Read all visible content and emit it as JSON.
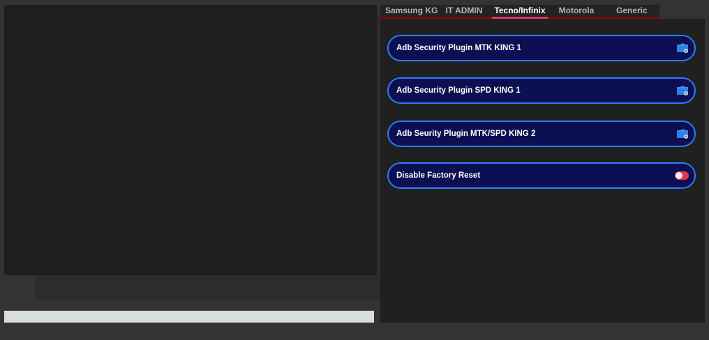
{
  "tabs": [
    {
      "label": "Samsung KG",
      "active": false
    },
    {
      "label": "IT ADMIN",
      "active": false
    },
    {
      "label": "Tecno/Infinix",
      "active": true
    },
    {
      "label": "Motorola",
      "active": false
    },
    {
      "label": "Generic",
      "active": false
    }
  ],
  "options": [
    {
      "label": "Adb Security Plugin MTK KING 1",
      "icon": "plugin-folder-icon"
    },
    {
      "label": "Adb Security Plugin SPD KING 1",
      "icon": "plugin-folder-icon"
    },
    {
      "label": "Adb Seurity Plugin MTK/SPD KING 2",
      "icon": "plugin-folder-icon"
    },
    {
      "label": "Disable Factory Reset",
      "icon": "toggle-switch",
      "toggle_state": "off"
    }
  ],
  "colors": {
    "accent_border": "#2f7cf6",
    "option_bg": "#0c0f52",
    "active_tab_underline": "#e0306a",
    "tabbar_underline": "#7a0c0c",
    "toggle": "#e8334f"
  }
}
